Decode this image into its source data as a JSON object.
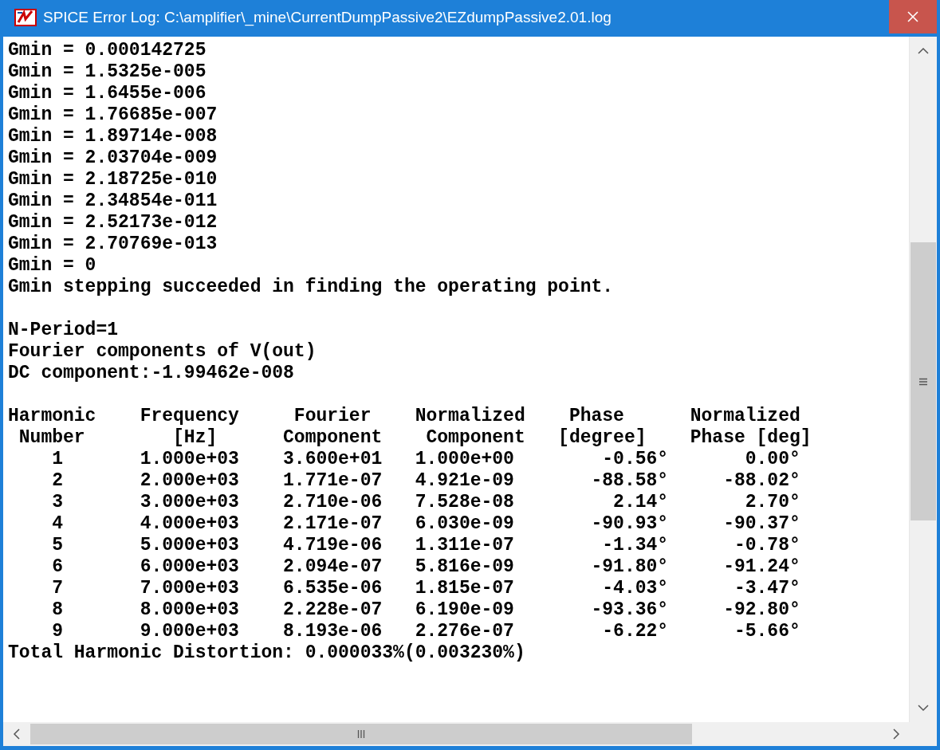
{
  "window": {
    "title": "SPICE Error Log: C:\\amplifier\\_mine\\CurrentDumpPassive2\\EZdumpPassive2.01.log"
  },
  "log_lines": [
    {
      "kind": "text",
      "text": "Gmin = 0.000142725"
    },
    {
      "kind": "text",
      "text": "Gmin = 1.5325e-005"
    },
    {
      "kind": "text",
      "text": "Gmin = 1.6455e-006"
    },
    {
      "kind": "text",
      "text": "Gmin = 1.76685e-007"
    },
    {
      "kind": "text",
      "text": "Gmin = 1.89714e-008"
    },
    {
      "kind": "text",
      "text": "Gmin = 2.03704e-009"
    },
    {
      "kind": "text",
      "text": "Gmin = 2.18725e-010"
    },
    {
      "kind": "text",
      "text": "Gmin = 2.34854e-011"
    },
    {
      "kind": "text",
      "text": "Gmin = 2.52173e-012"
    },
    {
      "kind": "text",
      "text": "Gmin = 2.70769e-013"
    },
    {
      "kind": "text",
      "text": "Gmin = 0"
    },
    {
      "kind": "text",
      "text": "Gmin stepping succeeded in finding the operating point."
    },
    {
      "kind": "blank"
    },
    {
      "kind": "text",
      "text": "N-Period=1"
    },
    {
      "kind": "text",
      "text": "Fourier components of V(out)"
    },
    {
      "kind": "text",
      "text": "DC component:-1.99462e-008"
    },
    {
      "kind": "blank"
    },
    {
      "kind": "text",
      "text": "Harmonic    Frequency     Fourier    Normalized    Phase      Normalized"
    },
    {
      "kind": "text",
      "text": " Number        [Hz]      Component    Component   [degree]    Phase [deg]"
    },
    {
      "kind": "text",
      "text": "    1       1.000e+03    3.600e+01   1.000e+00        -0.56°       0.00°"
    },
    {
      "kind": "text",
      "text": "    2       2.000e+03    1.771e-07   4.921e-09       -88.58°     -88.02°"
    },
    {
      "kind": "text",
      "text": "    3       3.000e+03    2.710e-06   7.528e-08         2.14°       2.70°"
    },
    {
      "kind": "text",
      "text": "    4       4.000e+03    2.171e-07   6.030e-09       -90.93°     -90.37°"
    },
    {
      "kind": "text",
      "text": "    5       5.000e+03    4.719e-06   1.311e-07        -1.34°      -0.78°"
    },
    {
      "kind": "text",
      "text": "    6       6.000e+03    2.094e-07   5.816e-09       -91.80°     -91.24°"
    },
    {
      "kind": "text",
      "text": "    7       7.000e+03    6.535e-06   1.815e-07        -4.03°      -3.47°"
    },
    {
      "kind": "text",
      "text": "    8       8.000e+03    2.228e-07   6.190e-09       -93.36°     -92.80°"
    },
    {
      "kind": "text",
      "text": "    9       9.000e+03    8.193e-06   2.276e-07        -6.22°      -5.66°"
    },
    {
      "kind": "text",
      "text": "Total Harmonic Distortion: 0.000033%(0.003230%)"
    }
  ]
}
